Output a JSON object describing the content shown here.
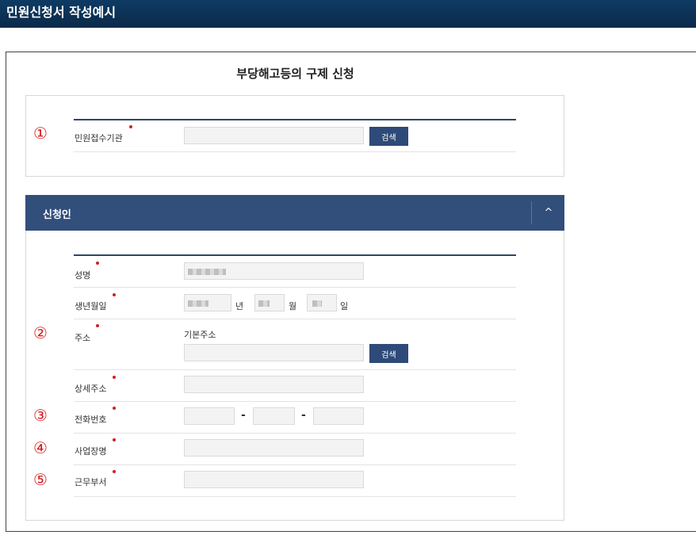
{
  "header": {
    "title": "민원신청서 작성예시"
  },
  "form": {
    "title": "부당해고등의 구제 신청"
  },
  "agency": {
    "marker": "①",
    "label": "민원접수기관",
    "search_label": "검색"
  },
  "applicant": {
    "section_title": "신청인",
    "collapse_icon": "^",
    "name_label": "성명",
    "birth_label": "생년월일",
    "year_unit": "년",
    "month_unit": "월",
    "day_unit": "일",
    "address_marker": "②",
    "address_label": "주소",
    "address_sub": "기본주소",
    "address_search_label": "검색",
    "detail_address_label": "상세주소",
    "phone_marker": "③",
    "phone_label": "전화번호",
    "phone_sep": "-",
    "business_marker": "④",
    "business_label": "사업장명",
    "department_marker": "⑤",
    "department_label": "근무부서"
  },
  "colors": {
    "header_bg": "#0c2a4a",
    "section_bg": "#324e7b",
    "button_bg": "#2e4a78",
    "required": "#d02020",
    "marker": "#d51c1c"
  }
}
